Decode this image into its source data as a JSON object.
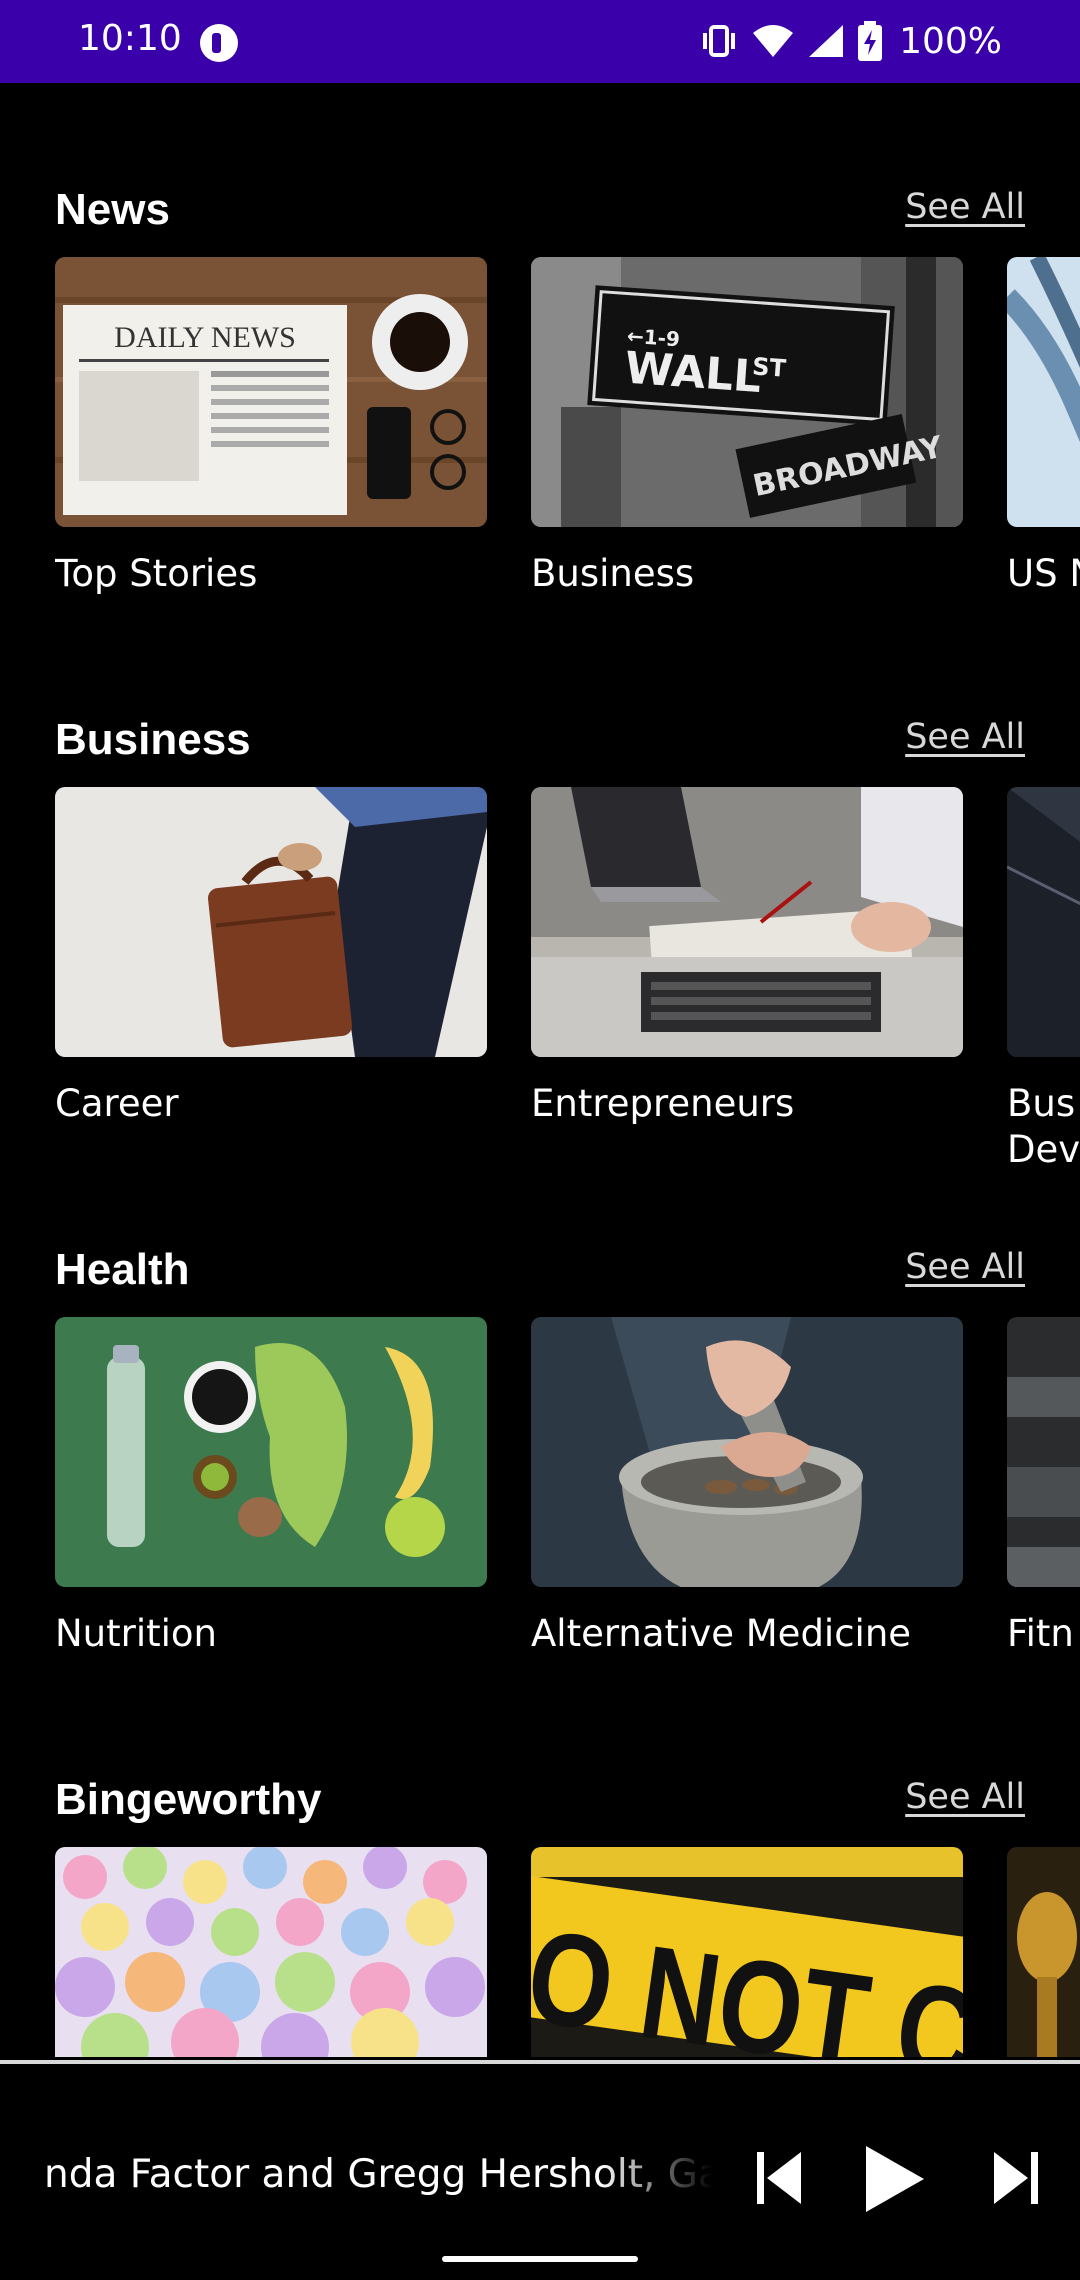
{
  "status_bar": {
    "time": "10:10",
    "battery": "100%",
    "icons": [
      "app-notification-icon",
      "vibrate-icon",
      "wifi-icon",
      "cell-signal-icon",
      "battery-charging-icon"
    ],
    "color": "#3a00aa"
  },
  "sections": [
    {
      "title": "News",
      "see_all": "See All",
      "cards": [
        {
          "label": "Top Stories",
          "image": "newspaper-coffee-photo"
        },
        {
          "label": "Business",
          "image": "wall-street-sign-photo"
        },
        {
          "label": "US N",
          "image": "cables-photo"
        }
      ]
    },
    {
      "title": "Business",
      "see_all": "See All",
      "cards": [
        {
          "label": "Career",
          "image": "briefcase-photo"
        },
        {
          "label": "Entrepreneurs",
          "image": "laptop-meeting-photo"
        },
        {
          "label": "Bus\nDev",
          "image": "office-building-photo"
        }
      ]
    },
    {
      "title": "Health",
      "see_all": "See All",
      "cards": [
        {
          "label": "Nutrition",
          "image": "healthy-food-photo"
        },
        {
          "label": "Alternative Medicine",
          "image": "mortar-pestle-photo"
        },
        {
          "label": "Fitn",
          "image": "gym-weights-photo"
        }
      ]
    },
    {
      "title": "Bingeworthy",
      "see_all": "See All",
      "cards": [
        {
          "label": "",
          "image": "candy-hearts-photo"
        },
        {
          "label": "",
          "image": "police-tape-photo"
        },
        {
          "label": "",
          "image": "gold-lamp-photo"
        }
      ]
    }
  ],
  "player": {
    "title": "nda Factor and Gregg Hersholt, Ga",
    "controls": [
      "skip-previous-icon",
      "play-icon",
      "skip-next-icon"
    ]
  }
}
